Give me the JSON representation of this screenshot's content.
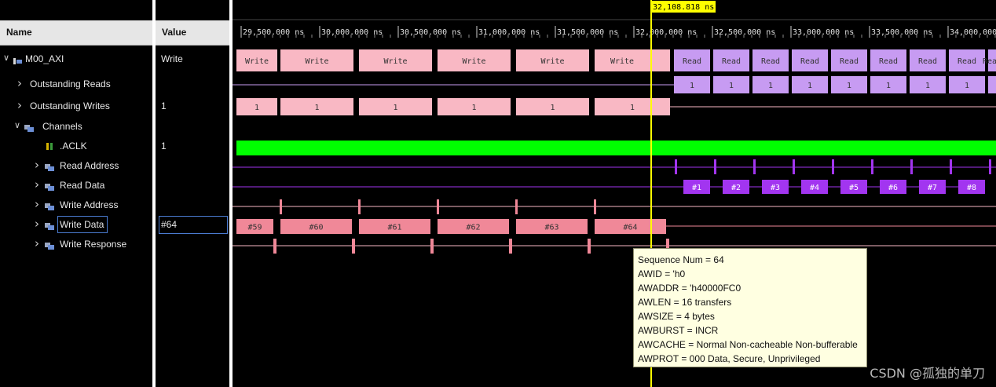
{
  "columns": {
    "name": "Name",
    "value": "Value"
  },
  "rows": [
    {
      "label": "M00_AXI",
      "value": "Write",
      "icon": "bus-icon",
      "expander": "expanded"
    },
    {
      "label": "Outstanding Reads",
      "value": "",
      "icon": "",
      "expander": "collapsed"
    },
    {
      "label": "Outstanding Writes",
      "value": "1",
      "icon": "",
      "expander": "collapsed"
    },
    {
      "label": "Channels",
      "value": "",
      "icon": "group-icon",
      "expander": "expanded"
    },
    {
      "label": ".ACLK",
      "value": "1",
      "icon": "clock-signal-icon",
      "expander": "none"
    },
    {
      "label": "Read Address",
      "value": "",
      "icon": "channel-icon",
      "expander": "collapsed"
    },
    {
      "label": "Read Data",
      "value": "",
      "icon": "channel-icon",
      "expander": "collapsed"
    },
    {
      "label": "Write Address",
      "value": "",
      "icon": "channel-icon",
      "expander": "collapsed"
    },
    {
      "label": "Write Data",
      "value": "#64",
      "icon": "channel-icon",
      "expander": "collapsed",
      "selected": true
    },
    {
      "label": "Write Response",
      "value": "",
      "icon": "channel-icon",
      "expander": "collapsed"
    }
  ],
  "timeline": {
    "ticks": [
      "29,500.000 ns",
      "30,000.000 ns",
      "30,500.000 ns",
      "31,000.000 ns",
      "31,500.000 ns",
      "32,000.000 ns",
      "32,500.000 ns",
      "33,000.000 ns",
      "33,500.000 ns",
      "34,000.000"
    ],
    "cursor_label": "32,108.818 ns"
  },
  "waves": {
    "transaction_writes": [
      "Write",
      "Write",
      "Write",
      "Write",
      "Write",
      "Write"
    ],
    "transaction_reads": [
      "Read",
      "Read",
      "Read",
      "Read",
      "Read",
      "Read",
      "Read",
      "Read",
      "Read"
    ],
    "outstanding_reads": [
      "1",
      "1",
      "1",
      "1",
      "1",
      "1",
      "1",
      "1"
    ],
    "outstanding_writes": [
      "1",
      "1",
      "1",
      "1",
      "1",
      "1"
    ],
    "read_data": [
      "#1",
      "#2",
      "#3",
      "#4",
      "#5",
      "#6",
      "#7",
      "#8"
    ],
    "write_data": [
      "#59",
      "#60",
      "#61",
      "#62",
      "#63",
      "#64"
    ]
  },
  "tooltip": {
    "lines": [
      "Sequence Num = 64",
      "AWID = 'h0",
      "AWADDR = 'h40000FC0",
      "AWLEN = 16 transfers",
      "AWSIZE = 4 bytes",
      "AWBURST = INCR",
      "AWCACHE = Normal Non-cacheable Non-bufferable",
      "AWPROT = 000 Data, Secure, Unprivileged"
    ]
  },
  "watermark": "CSDN @孤独的单刀",
  "colors": {
    "write": "#f9b8c4",
    "write_data": "#f08898",
    "read": "#c79bf2",
    "read_data": "#a235f0",
    "clock": "#00ff00",
    "cursor": "#ffff00"
  }
}
